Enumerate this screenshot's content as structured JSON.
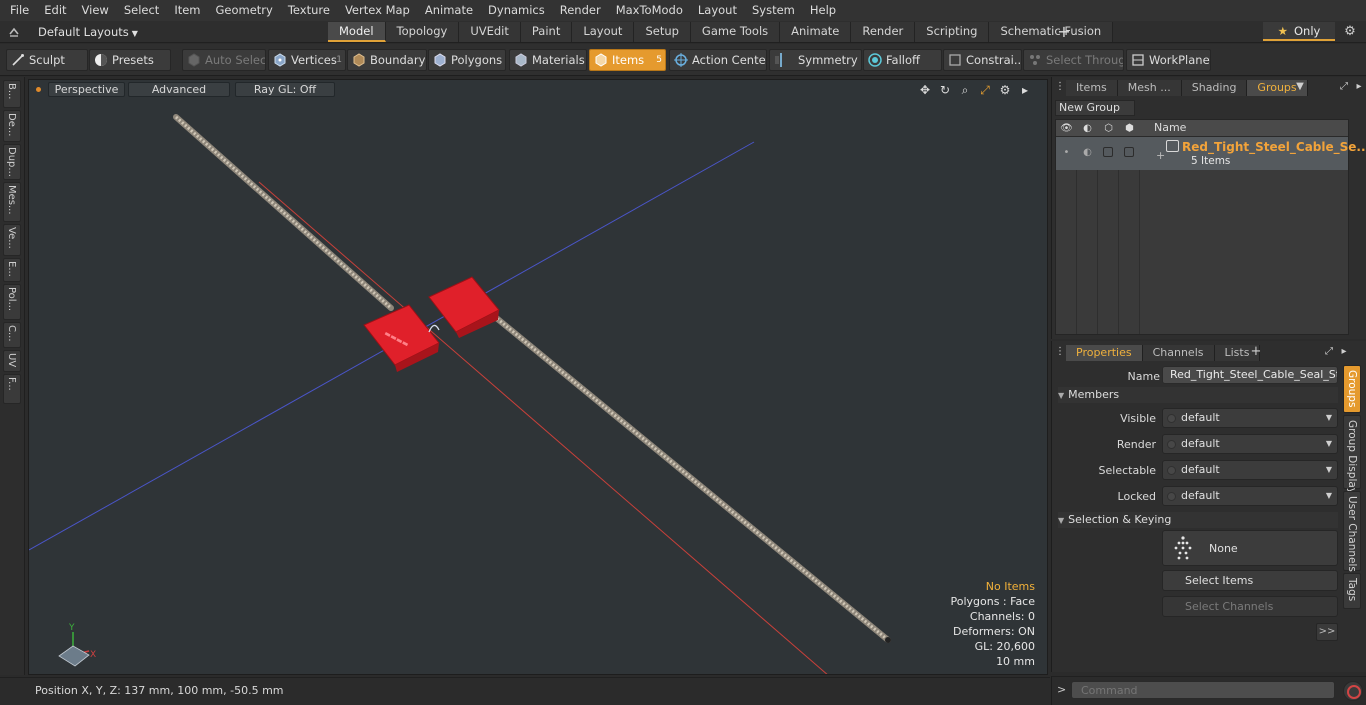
{
  "menu": [
    "File",
    "Edit",
    "View",
    "Select",
    "Item",
    "Geometry",
    "Texture",
    "Vertex Map",
    "Animate",
    "Dynamics",
    "Render",
    "MaxToModo",
    "Layout",
    "System",
    "Help"
  ],
  "layout_selector": "Default Layouts",
  "tabs": [
    {
      "label": "Model",
      "active": true
    },
    {
      "label": "Topology",
      "active": false
    },
    {
      "label": "UVEdit",
      "active": false
    },
    {
      "label": "Paint",
      "active": false
    },
    {
      "label": "Layout",
      "active": false
    },
    {
      "label": "Setup",
      "active": false
    },
    {
      "label": "Game Tools",
      "active": false
    },
    {
      "label": "Animate",
      "active": false
    },
    {
      "label": "Render",
      "active": false
    },
    {
      "label": "Scripting",
      "active": false
    },
    {
      "label": "Schematic Fusion",
      "active": false
    }
  ],
  "only_label": "Only",
  "toolbar": {
    "sculpt": "Sculpt",
    "presets": "Presets",
    "auto_select": "Auto Select",
    "vertices": "Vertices",
    "vertices_count": "1",
    "boundary": "Boundary",
    "polygons": "Polygons",
    "materials": "Materials",
    "items": "Items",
    "items_count": "5",
    "action_center": "Action Center",
    "symmetry": "Symmetry",
    "falloff": "Falloff",
    "constraints": "Constrai...",
    "select_through": "Select Through",
    "workplane": "WorkPlane"
  },
  "left_tabs": [
    "B...",
    "De...",
    "Dup...",
    "Mes...",
    "Ve...",
    "E...",
    "Pol...",
    "C...",
    "UV",
    "F..."
  ],
  "viewport": {
    "projection": "Perspective",
    "style": "Advanced",
    "raygl": "Ray GL: Off",
    "info": {
      "selection": "No Items",
      "polygons": "Polygons : Face",
      "channels": "Channels: 0",
      "deformers": "Deformers: ON",
      "gl": "GL: 20,600",
      "scale": "10 mm"
    },
    "axis_labels": {
      "y": "Y",
      "x": "X"
    }
  },
  "status": {
    "position": "Position X, Y, Z:   137 mm, 100 mm, -50.5 mm"
  },
  "top_panel": {
    "tabs": [
      {
        "label": "Items",
        "active": false
      },
      {
        "label": "Mesh ...",
        "active": false
      },
      {
        "label": "Shading",
        "active": false
      },
      {
        "label": "Groups",
        "active": true
      }
    ],
    "new_group": "New Group",
    "name_header": "Name",
    "group": {
      "name": "Red_Tight_Steel_Cable_Se...",
      "count": "5 Items"
    }
  },
  "props_panel": {
    "tabs": [
      {
        "label": "Properties",
        "active": true
      },
      {
        "label": "Channels",
        "active": false
      },
      {
        "label": "Lists",
        "active": false
      }
    ],
    "name_label": "Name",
    "name_value": "Red_Tight_Steel_Cable_Seal_Stra",
    "members_section": "Members",
    "rows": [
      {
        "label": "Visible",
        "value": "default"
      },
      {
        "label": "Render",
        "value": "default"
      },
      {
        "label": "Selectable",
        "value": "default"
      },
      {
        "label": "Locked",
        "value": "default"
      }
    ],
    "selection_section": "Selection & Keying",
    "none_label": "None",
    "select_items": "Select Items",
    "select_channels": "Select Channels",
    "more": ">>"
  },
  "right_vtabs": [
    {
      "label": "Groups",
      "active": true
    },
    {
      "label": "Group Display",
      "active": false
    },
    {
      "label": "User Channels",
      "active": false
    },
    {
      "label": "Tags",
      "active": false
    }
  ],
  "command": {
    "placeholder": "Command"
  },
  "colors": {
    "accent": "#e59a2e",
    "group_name": "#f2a33a",
    "seal_red": "#e0202a",
    "axis_red": "#c8403a",
    "axis_blue": "#4a55c8"
  }
}
